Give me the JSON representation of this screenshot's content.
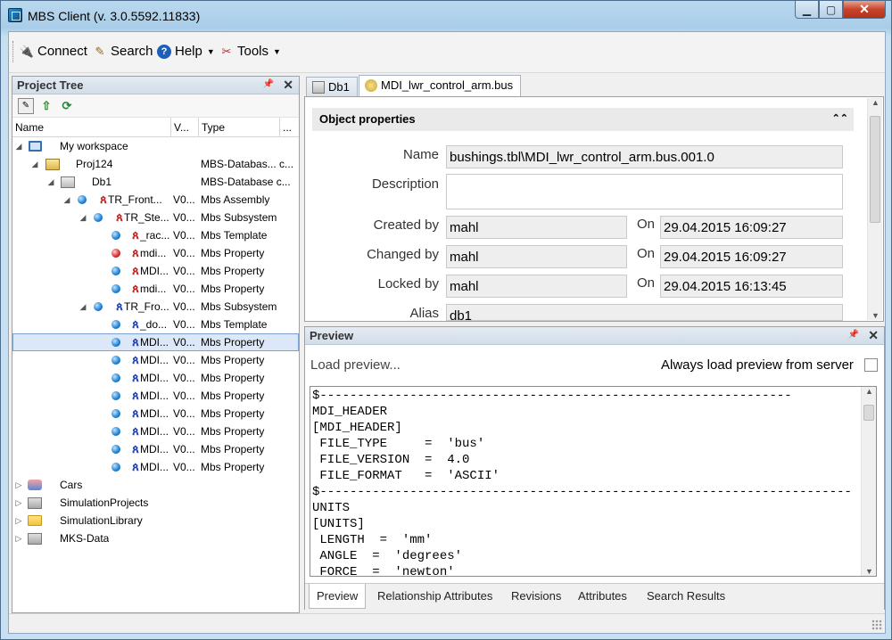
{
  "window": {
    "title": "MBS Client (v. 3.0.5592.11833)"
  },
  "toolbar": {
    "connect": "Connect",
    "search": "Search",
    "help": "Help",
    "tools": "Tools"
  },
  "project_tree": {
    "title": "Project Tree",
    "columns": {
      "name": "Name",
      "version": "V...",
      "type": "Type",
      "more": "..."
    },
    "rows": [
      {
        "name": "My workspace",
        "version": "",
        "type": ""
      },
      {
        "name": "Proj124",
        "version": "",
        "type": "MBS-Databas... c..."
      },
      {
        "name": "Db1",
        "version": "",
        "type": "MBS-Database  c..."
      },
      {
        "name": "TR_Front...",
        "version": "V0...",
        "type": "Mbs Assembly"
      },
      {
        "name": "TR_Ste...",
        "version": "V0...",
        "type": "Mbs Subsystem"
      },
      {
        "name": "_rac...",
        "version": "V0...",
        "type": "Mbs Template"
      },
      {
        "name": "mdi...",
        "version": "V0...",
        "type": "Mbs Property"
      },
      {
        "name": "MDI...",
        "version": "V0...",
        "type": "Mbs Property"
      },
      {
        "name": "mdi...",
        "version": "V0...",
        "type": "Mbs Property"
      },
      {
        "name": "TR_Fro...",
        "version": "V0...",
        "type": "Mbs Subsystem"
      },
      {
        "name": "_do...",
        "version": "V0...",
        "type": "Mbs Template"
      },
      {
        "name": "MDI...",
        "version": "V0...",
        "type": "Mbs Property"
      },
      {
        "name": "MDI...",
        "version": "V0...",
        "type": "Mbs Property"
      },
      {
        "name": "MDI...",
        "version": "V0...",
        "type": "Mbs Property"
      },
      {
        "name": "MDI...",
        "version": "V0...",
        "type": "Mbs Property"
      },
      {
        "name": "MDI...",
        "version": "V0...",
        "type": "Mbs Property"
      },
      {
        "name": "MDI...",
        "version": "V0...",
        "type": "Mbs Property"
      },
      {
        "name": "MDI...",
        "version": "V0...",
        "type": "Mbs Property"
      },
      {
        "name": "MDI...",
        "version": "V0...",
        "type": "Mbs Property"
      },
      {
        "name": "Cars",
        "version": "",
        "type": ""
      },
      {
        "name": "SimulationProjects",
        "version": "",
        "type": ""
      },
      {
        "name": "SimulationLibrary",
        "version": "",
        "type": ""
      },
      {
        "name": "MKS-Data",
        "version": "",
        "type": ""
      }
    ]
  },
  "doc_tabs": {
    "tab1": "Db1",
    "tab2": "MDI_lwr_control_arm.bus"
  },
  "object_properties": {
    "title": "Object properties",
    "name_label": "Name",
    "name_value": "bushings.tbl\\MDI_lwr_control_arm.bus.001.0",
    "description_label": "Description",
    "description_value": "",
    "created_by_label": "Created by",
    "created_by_value": "mahl",
    "created_on_label": "On",
    "created_on_value": "29.04.2015 16:09:27",
    "changed_by_label": "Changed by",
    "changed_by_value": "mahl",
    "changed_on_label": "On",
    "changed_on_value": "29.04.2015 16:09:27",
    "locked_by_label": "Locked by",
    "locked_by_value": "mahl",
    "locked_on_label": "On",
    "locked_on_value": "29.04.2015 16:13:45",
    "alias_label": "Alias",
    "alias_value": "db1"
  },
  "preview": {
    "title": "Preview",
    "load_preview": "Load preview...",
    "always_load": "Always load preview from server",
    "code": "$---------------------------------------------------------------\nMDI_HEADER\n[MDI_HEADER]\n FILE_TYPE     =  'bus'\n FILE_VERSION  =  4.0\n FILE_FORMAT   =  'ASCII'\n$-----------------------------------------------------------------------\nUNITS\n[UNITS]\n LENGTH  =  'mm'\n ANGLE  =  'degrees'\n FORCE  =  'newton'",
    "tabs": [
      "Preview",
      "Relationship Attributes",
      "Revisions",
      "Attributes",
      "Search Results"
    ]
  }
}
